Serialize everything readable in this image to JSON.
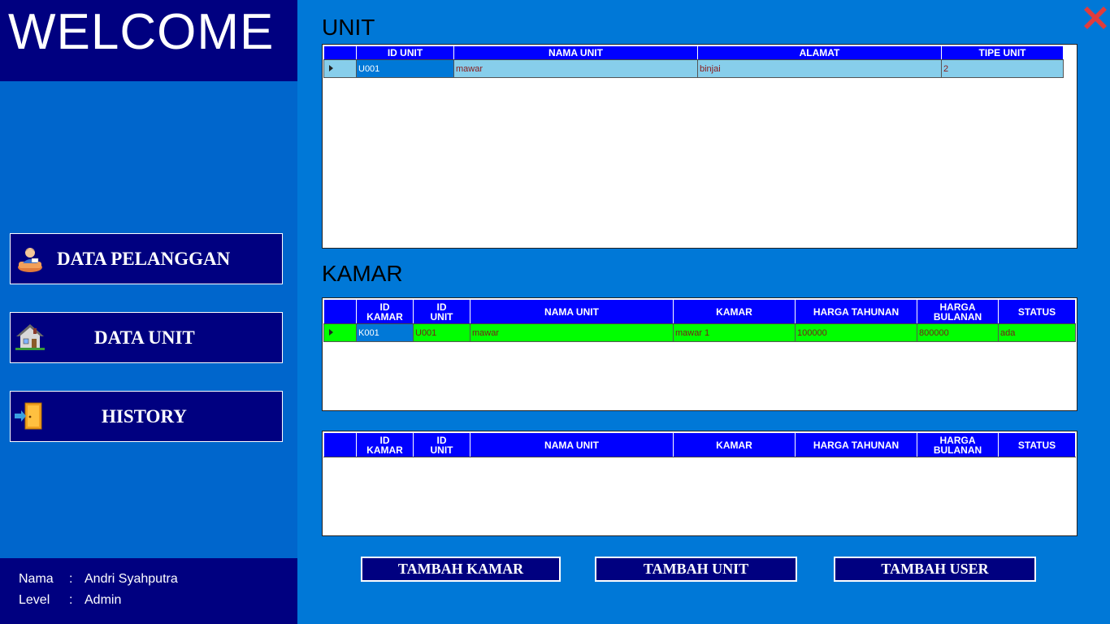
{
  "sidebar": {
    "welcome": "WELCOME",
    "nav": [
      {
        "label": "DATA PELANGGAN",
        "icon": "customer-icon"
      },
      {
        "label": "DATA UNIT",
        "icon": "house-icon"
      },
      {
        "label": "HISTORY",
        "icon": "door-exit-icon"
      }
    ],
    "user": {
      "nama_label": "Nama",
      "nama_value": "Andri Syahputra",
      "level_label": "Level",
      "level_value": "Admin",
      "separator": ":"
    }
  },
  "unit": {
    "title": "UNIT",
    "columns": [
      "ID UNIT",
      "NAMA UNIT",
      "ALAMAT",
      "TIPE UNIT"
    ],
    "rows": [
      [
        "U001",
        "mawar",
        "binjai",
        "2"
      ]
    ]
  },
  "kamar": {
    "title": "KAMAR",
    "columns": [
      "ID\nKAMAR",
      "ID\nUNIT",
      "NAMA UNIT",
      "KAMAR",
      "HARGA TAHUNAN",
      "HARGA\nBULANAN",
      "STATUS"
    ],
    "rows": [
      [
        "K001",
        "U001",
        "mawar",
        "mawar 1",
        "100000",
        "800000",
        "ada"
      ]
    ]
  },
  "kamar2": {
    "columns": [
      "ID\nKAMAR",
      "ID\nUNIT",
      "NAMA UNIT",
      "KAMAR",
      "HARGA TAHUNAN",
      "HARGA\nBULANAN",
      "STATUS"
    ],
    "rows": []
  },
  "actions": {
    "tambah_kamar": "TAMBAH KAMAR",
    "tambah_unit": "TAMBAH UNIT",
    "tambah_user": "TAMBAH USER"
  },
  "colors": {
    "header_blue": "#0000ff",
    "navy": "#000080",
    "unit_row": "#87ceeb",
    "kamar_row": "#00ff00",
    "close": "#e03c3c"
  }
}
